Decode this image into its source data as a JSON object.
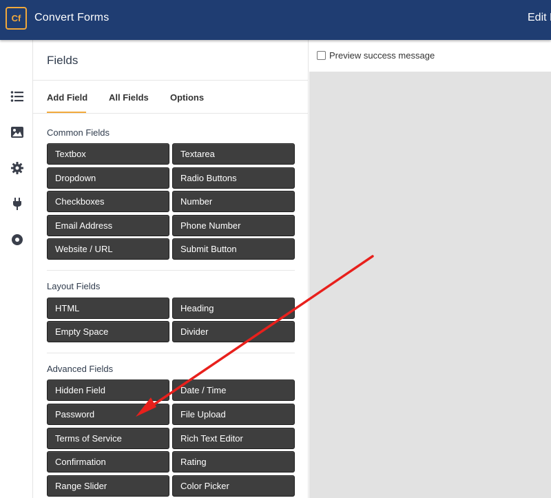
{
  "header": {
    "logo_text": "Cf",
    "app_name": "Convert Forms",
    "edit_label": "Edit F",
    "bg_color": "#1f3d72",
    "accent_color": "#f2a93b"
  },
  "sidebar_icons": [
    "list-icon",
    "image-icon",
    "gear-icon",
    "plug-icon",
    "circle-target-icon"
  ],
  "panel": {
    "title": "Fields",
    "tabs": [
      {
        "label": "Add Field",
        "active": true
      },
      {
        "label": "All Fields",
        "active": false
      },
      {
        "label": "Options",
        "active": false
      }
    ],
    "sections": [
      {
        "title": "Common Fields",
        "fields": [
          "Textbox",
          "Textarea",
          "Dropdown",
          "Radio Buttons",
          "Checkboxes",
          "Number",
          "Email Address",
          "Phone Number",
          "Website / URL",
          "Submit Button"
        ]
      },
      {
        "title": "Layout Fields",
        "fields": [
          "HTML",
          "Heading",
          "Empty Space",
          "Divider"
        ]
      },
      {
        "title": "Advanced Fields",
        "fields": [
          "Hidden Field",
          "Date / Time",
          "Password",
          "File Upload",
          "Terms of Service",
          "Rich Text Editor",
          "Confirmation",
          "Rating",
          "Range Slider",
          "Color Picker"
        ]
      }
    ]
  },
  "preview": {
    "checkbox_label": "Preview success message",
    "checked": false
  },
  "annotation": {
    "arrow_color": "#e8201c",
    "points_to": "Password"
  }
}
